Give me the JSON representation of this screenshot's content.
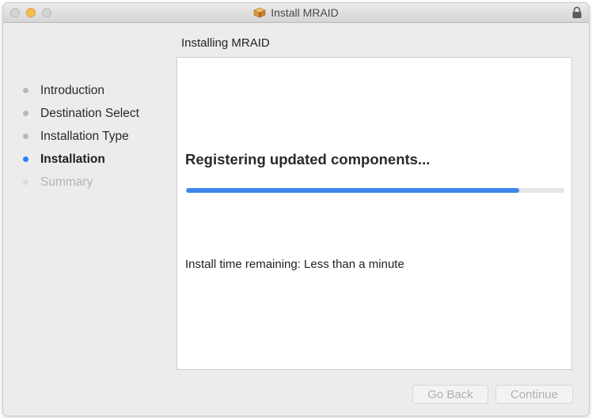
{
  "window": {
    "title": "Install MRAID",
    "title_icon": "package-icon",
    "lock_icon": "lock-icon"
  },
  "heading": "Installing MRAID",
  "steps": [
    {
      "label": "Introduction",
      "state": "done"
    },
    {
      "label": "Destination Select",
      "state": "done"
    },
    {
      "label": "Installation Type",
      "state": "done"
    },
    {
      "label": "Installation",
      "state": "active"
    },
    {
      "label": "Summary",
      "state": "future"
    }
  ],
  "main": {
    "status": "Registering updated components...",
    "progress": 0.88,
    "remaining": "Install time remaining: Less than a minute"
  },
  "buttons": {
    "back_label": "Go Back",
    "continue_label": "Continue"
  },
  "colors": {
    "accent": "#2d7cf6",
    "progress_fill": "#3f86ee"
  }
}
